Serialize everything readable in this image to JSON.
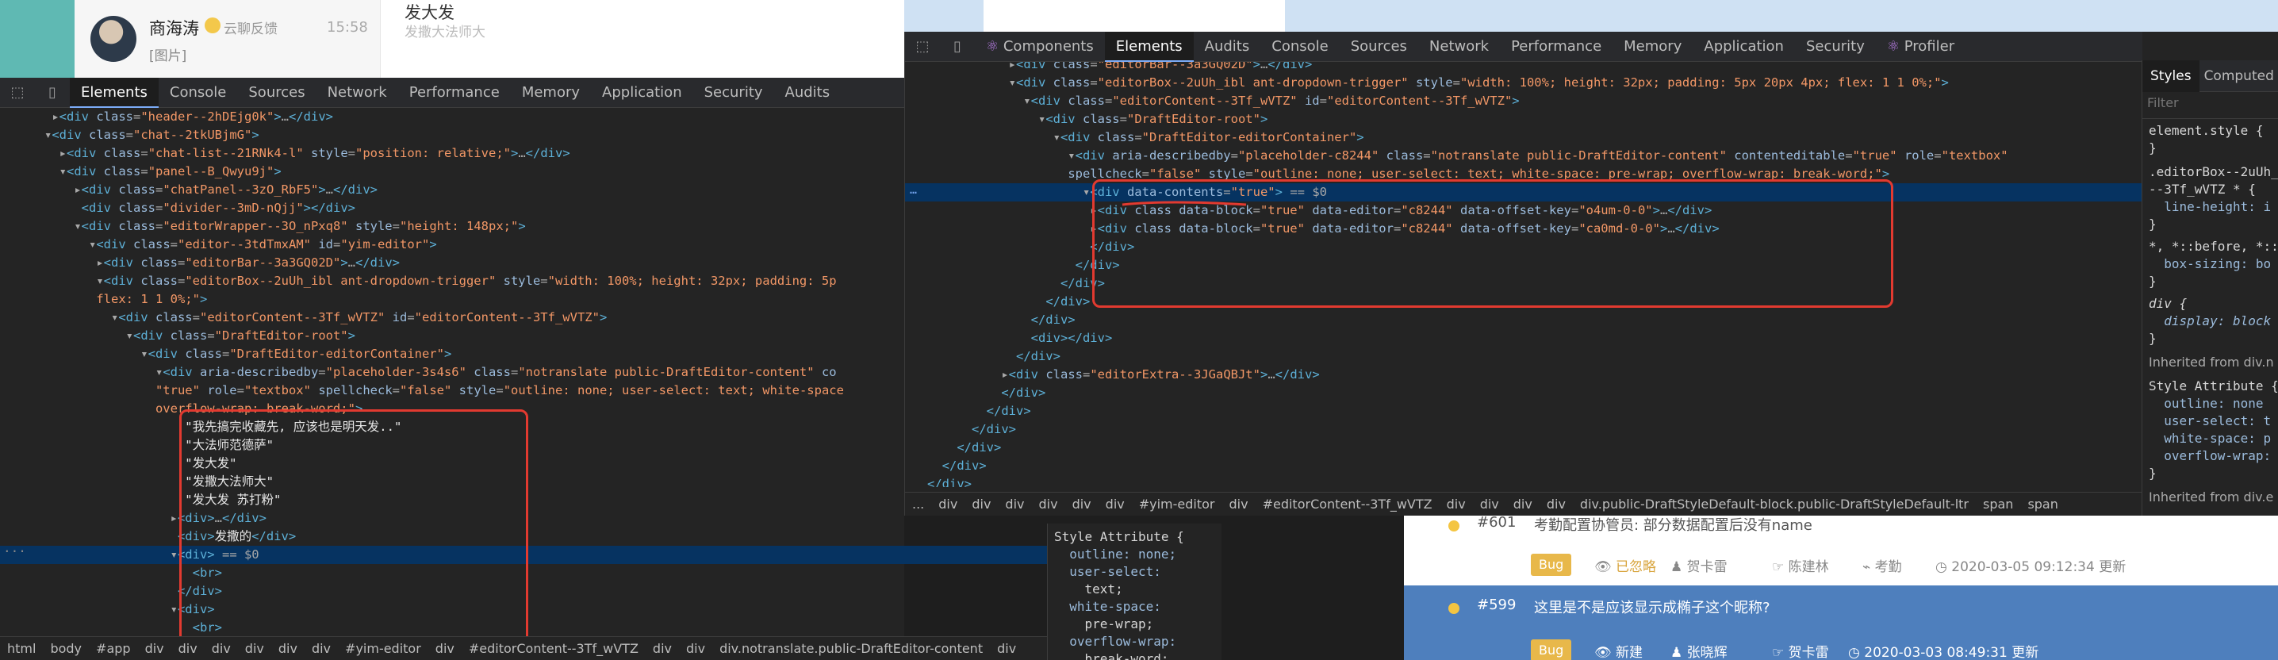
{
  "chat": {
    "name": "商海涛",
    "tag": "云聊反馈",
    "time": "15:58",
    "preview": "[图片]",
    "message": "发大发",
    "message_sub": "发撒大法师大"
  },
  "left_devtools": {
    "tabs": [
      "Elements",
      "Console",
      "Sources",
      "Network",
      "Performance",
      "Memory",
      "Application",
      "Security",
      "Audits"
    ],
    "active_tab": "Elements",
    "breadcrumb": [
      "html",
      "body",
      "#app",
      "div",
      "div",
      "div",
      "div",
      "div",
      "div",
      "#yim-editor",
      "div",
      "#editorContent--3Tf_wVTZ",
      "div",
      "div",
      "div.notranslate.public-DraftEditor-content",
      "div"
    ]
  },
  "right_devtools": {
    "tabs": [
      "Components",
      "Elements",
      "Audits",
      "Console",
      "Sources",
      "Network",
      "Performance",
      "Memory",
      "Application",
      "Security",
      "Profiler"
    ],
    "active_tab": "Elements",
    "breadcrumb": [
      "...",
      "div",
      "div",
      "div",
      "div",
      "div",
      "div",
      "#yim-editor",
      "div",
      "#editorContent--3Tf_wVTZ",
      "div",
      "div",
      "div",
      "div",
      "div.public-DraftStyleDefault-block.public-DraftStyleDefault-ltr",
      "span",
      "span"
    ],
    "styles_tabs": [
      "Styles",
      "Computed"
    ],
    "filter_placeholder": "Filter"
  },
  "style_attr_left": [
    "Style Attribute {",
    "  outline: none;",
    "  user-select:",
    "    text;",
    "  white-space:",
    "    pre-wrap;",
    "  overflow-wrap:",
    "    break-word;"
  ],
  "styles_right": [
    "element.style {",
    "}",
    ".editorBox--2uUh_",
    "--3Tf_wVTZ * {",
    "  line-height: i",
    "}",
    "*, *::before, *::",
    "  box-sizing: bo",
    "}",
    "div {",
    "  display: block",
    "}",
    "Inherited from div.n",
    "Style Attribute {",
    "  outline: none",
    "  user-select: t",
    "  white-space: p",
    "  overflow-wrap:",
    "}",
    "Inherited from div.e"
  ],
  "issues": [
    {
      "id": "#601",
      "title": "考勤配置协管员: 部分数据配置后没有name",
      "status": "已忽略",
      "assignee": "贺卡雷",
      "reporter": "陈建林",
      "module": "考勤",
      "updated": "2020-03-05 09:12:34 更新"
    },
    {
      "id": "#599",
      "title": "这里是不是应该显示成椭子这个昵称?",
      "status": "新建",
      "assignee": "张晓辉",
      "reporter": "贺卡雷",
      "updated": "2020-03-03 08:49:31 更新"
    }
  ],
  "bug_label": "Bug"
}
